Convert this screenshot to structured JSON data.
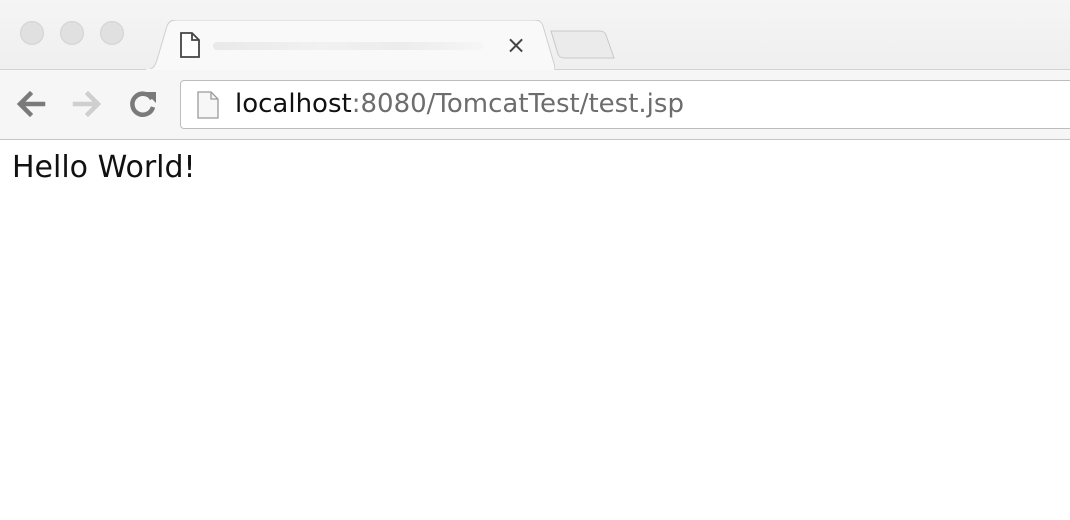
{
  "browser": {
    "tab": {
      "close_glyph": "×",
      "icon": "document-icon"
    },
    "toolbar": {
      "back_icon": "back-arrow-icon",
      "forward_icon": "forward-arrow-icon",
      "reload_icon": "reload-icon"
    },
    "address_bar": {
      "icon": "page-icon",
      "host": "localhost",
      "rest": ":8080/TomcatTest/test.jsp"
    }
  },
  "page": {
    "text": "Hello World!"
  },
  "colors": {
    "chrome_background": "#f5f5f5",
    "url_host": "#111111",
    "url_path": "#6d6d6d",
    "back_icon": "#7a7a7a",
    "forward_icon_disabled": "#cfcfcf"
  }
}
